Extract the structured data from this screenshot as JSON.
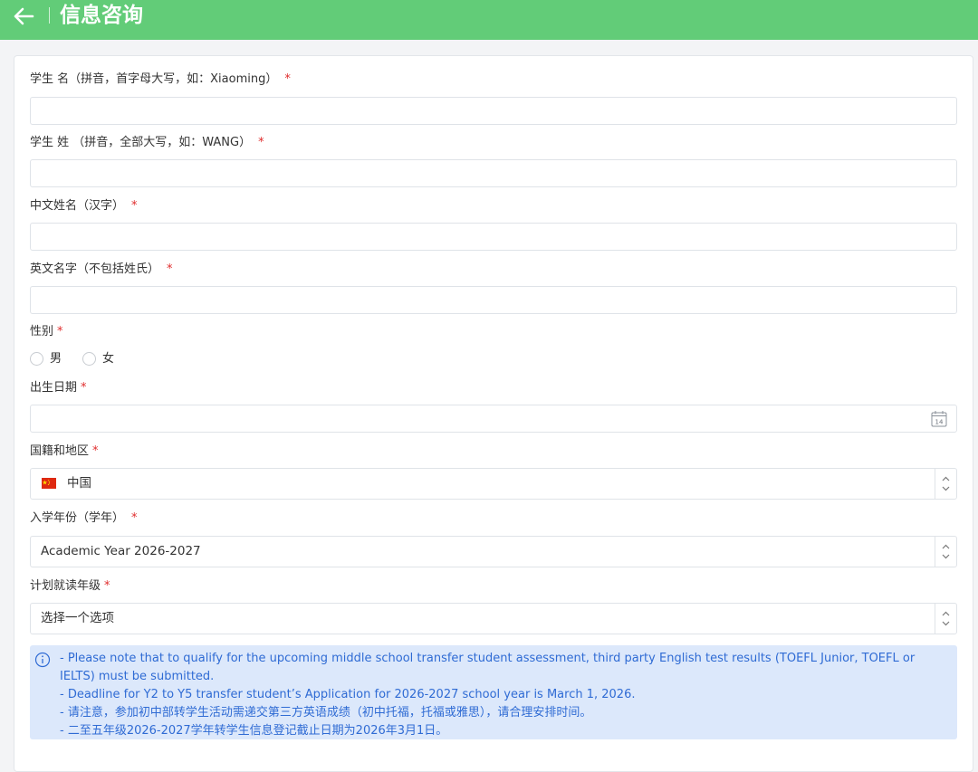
{
  "header": {
    "title": "信息咨询"
  },
  "form": {
    "first_name": {
      "label": "学生 名（拼音，首字母大写，如：Xiaoming）",
      "required_mark": "*",
      "value": ""
    },
    "last_name": {
      "label": "学生 姓 （拼音，全部大写，如：WANG）",
      "required_mark": "*",
      "value": ""
    },
    "chinese_name": {
      "label": "中文姓名（汉字）",
      "required_mark": "*",
      "value": ""
    },
    "english_name": {
      "label": "英文名字（不包括姓氏）",
      "required_mark": "*",
      "value": ""
    },
    "gender": {
      "label": "性别",
      "required_mark": "*",
      "options": [
        "男",
        "女"
      ],
      "selected": null
    },
    "birth_date": {
      "label": "出生日期",
      "required_mark": "*",
      "value": "",
      "calendar_day": "14"
    },
    "nationality": {
      "label": "国籍和地区",
      "required_mark": "*",
      "value": "中国",
      "flag_color": "#de2910"
    },
    "entry_year": {
      "label": "入学年份（学年）",
      "required_mark": "*",
      "value": "Academic Year 2026-2027"
    },
    "grade": {
      "label": "计划就读年级",
      "required_mark": "*",
      "value": "选择一个选项"
    }
  },
  "notice": {
    "lines": [
      "- Please note that to qualify for the upcoming middle school transfer student assessment, third party English test results (TOEFL Junior, TOEFL or IELTS) must be submitted.",
      "- Deadline for Y2 to Y5 transfer student’s Application for 2026-2027 school year is March 1, 2026.",
      "- 请注意，参加初中部转学生活动需递交第三方英语成绩（初中托福，托福或雅思），请合理安排时间。",
      "- 二至五年级2026-2027学年转学生信息登记截止日期为2026年3月1日。"
    ]
  },
  "colors": {
    "header": "#62cc78",
    "required": "#e02c2c",
    "notice_bg": "#dce8fb",
    "notice_text": "#2f6bd4"
  }
}
